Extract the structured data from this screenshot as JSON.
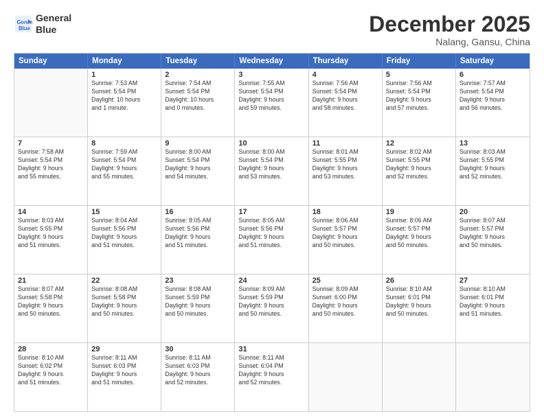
{
  "header": {
    "logo_line1": "General",
    "logo_line2": "Blue",
    "month": "December 2025",
    "location": "Nalang, Gansu, China"
  },
  "weekdays": [
    "Sunday",
    "Monday",
    "Tuesday",
    "Wednesday",
    "Thursday",
    "Friday",
    "Saturday"
  ],
  "rows": [
    [
      {
        "day": "",
        "info": ""
      },
      {
        "day": "1",
        "info": "Sunrise: 7:53 AM\nSunset: 5:54 PM\nDaylight: 10 hours\nand 1 minute."
      },
      {
        "day": "2",
        "info": "Sunrise: 7:54 AM\nSunset: 5:54 PM\nDaylight: 10 hours\nand 0 minutes."
      },
      {
        "day": "3",
        "info": "Sunrise: 7:55 AM\nSunset: 5:54 PM\nDaylight: 9 hours\nand 59 minutes."
      },
      {
        "day": "4",
        "info": "Sunrise: 7:56 AM\nSunset: 5:54 PM\nDaylight: 9 hours\nand 58 minutes."
      },
      {
        "day": "5",
        "info": "Sunrise: 7:56 AM\nSunset: 5:54 PM\nDaylight: 9 hours\nand 57 minutes."
      },
      {
        "day": "6",
        "info": "Sunrise: 7:57 AM\nSunset: 5:54 PM\nDaylight: 9 hours\nand 56 minutes."
      }
    ],
    [
      {
        "day": "7",
        "info": "Sunrise: 7:58 AM\nSunset: 5:54 PM\nDaylight: 9 hours\nand 55 minutes."
      },
      {
        "day": "8",
        "info": "Sunrise: 7:59 AM\nSunset: 5:54 PM\nDaylight: 9 hours\nand 55 minutes."
      },
      {
        "day": "9",
        "info": "Sunrise: 8:00 AM\nSunset: 5:54 PM\nDaylight: 9 hours\nand 54 minutes."
      },
      {
        "day": "10",
        "info": "Sunrise: 8:00 AM\nSunset: 5:54 PM\nDaylight: 9 hours\nand 53 minutes."
      },
      {
        "day": "11",
        "info": "Sunrise: 8:01 AM\nSunset: 5:55 PM\nDaylight: 9 hours\nand 53 minutes."
      },
      {
        "day": "12",
        "info": "Sunrise: 8:02 AM\nSunset: 5:55 PM\nDaylight: 9 hours\nand 52 minutes."
      },
      {
        "day": "13",
        "info": "Sunrise: 8:03 AM\nSunset: 5:55 PM\nDaylight: 9 hours\nand 52 minutes."
      }
    ],
    [
      {
        "day": "14",
        "info": "Sunrise: 8:03 AM\nSunset: 5:55 PM\nDaylight: 9 hours\nand 51 minutes."
      },
      {
        "day": "15",
        "info": "Sunrise: 8:04 AM\nSunset: 5:56 PM\nDaylight: 9 hours\nand 51 minutes."
      },
      {
        "day": "16",
        "info": "Sunrise: 8:05 AM\nSunset: 5:56 PM\nDaylight: 9 hours\nand 51 minutes."
      },
      {
        "day": "17",
        "info": "Sunrise: 8:05 AM\nSunset: 5:56 PM\nDaylight: 9 hours\nand 51 minutes."
      },
      {
        "day": "18",
        "info": "Sunrise: 8:06 AM\nSunset: 5:57 PM\nDaylight: 9 hours\nand 50 minutes."
      },
      {
        "day": "19",
        "info": "Sunrise: 8:06 AM\nSunset: 5:57 PM\nDaylight: 9 hours\nand 50 minutes."
      },
      {
        "day": "20",
        "info": "Sunrise: 8:07 AM\nSunset: 5:57 PM\nDaylight: 9 hours\nand 50 minutes."
      }
    ],
    [
      {
        "day": "21",
        "info": "Sunrise: 8:07 AM\nSunset: 5:58 PM\nDaylight: 9 hours\nand 50 minutes."
      },
      {
        "day": "22",
        "info": "Sunrise: 8:08 AM\nSunset: 5:58 PM\nDaylight: 9 hours\nand 50 minutes."
      },
      {
        "day": "23",
        "info": "Sunrise: 8:08 AM\nSunset: 5:59 PM\nDaylight: 9 hours\nand 50 minutes."
      },
      {
        "day": "24",
        "info": "Sunrise: 8:09 AM\nSunset: 5:59 PM\nDaylight: 9 hours\nand 50 minutes."
      },
      {
        "day": "25",
        "info": "Sunrise: 8:09 AM\nSunset: 6:00 PM\nDaylight: 9 hours\nand 50 minutes."
      },
      {
        "day": "26",
        "info": "Sunrise: 8:10 AM\nSunset: 6:01 PM\nDaylight: 9 hours\nand 50 minutes."
      },
      {
        "day": "27",
        "info": "Sunrise: 8:10 AM\nSunset: 6:01 PM\nDaylight: 9 hours\nand 51 minutes."
      }
    ],
    [
      {
        "day": "28",
        "info": "Sunrise: 8:10 AM\nSunset: 6:02 PM\nDaylight: 9 hours\nand 51 minutes."
      },
      {
        "day": "29",
        "info": "Sunrise: 8:11 AM\nSunset: 6:03 PM\nDaylight: 9 hours\nand 51 minutes."
      },
      {
        "day": "30",
        "info": "Sunrise: 8:11 AM\nSunset: 6:03 PM\nDaylight: 9 hours\nand 52 minutes."
      },
      {
        "day": "31",
        "info": "Sunrise: 8:11 AM\nSunset: 6:04 PM\nDaylight: 9 hours\nand 52 minutes."
      },
      {
        "day": "",
        "info": ""
      },
      {
        "day": "",
        "info": ""
      },
      {
        "day": "",
        "info": ""
      }
    ]
  ]
}
